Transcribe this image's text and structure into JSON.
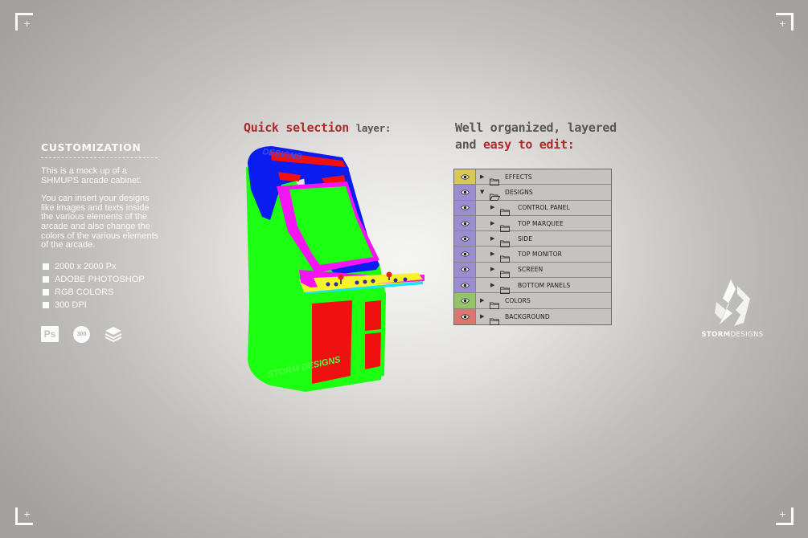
{
  "left": {
    "heading": "CUSTOMIZATION",
    "paragraph1": "This is a mock up of a SHMUPS arcade cabinet.",
    "paragraph2": "You can insert your designs like images and texts inside the various elements of the arcade and also change the colors of the various elements of the arcade.",
    "specs": [
      "2000 x 2000 Px",
      "ADOBE PHOTOSHOP",
      "RGB COLORS",
      "300 DPI"
    ],
    "icons": [
      "photoshop-icon",
      "dpi-300-icon",
      "layers-icon"
    ],
    "ps_label": "Ps",
    "dpi_label": "300"
  },
  "headings": {
    "quick_accent": "Quick selection",
    "quick_rest": "layer:",
    "well_line1": "Well organized, layered",
    "well_line2_a": "and",
    "well_line2_accent": "easy to edit:"
  },
  "arcade": {
    "watermark_top": "DESIGNS",
    "watermark_bottom": "STORM DESIGNS",
    "colors": {
      "blue": "#0a1cf0",
      "red": "#f01010",
      "green": "#1cfe12",
      "magenta": "#f614f4",
      "yellow": "#f6f32a",
      "cyan": "#18e6f8"
    }
  },
  "layers": [
    {
      "name": "EFFECTS",
      "color": "#d9c954",
      "expanded": false,
      "sub": false
    },
    {
      "name": "DESIGNS",
      "color": "#9a8ed0",
      "expanded": true,
      "sub": false
    },
    {
      "name": "CONTROL PANEL",
      "color": "#9a8ed0",
      "expanded": false,
      "sub": true
    },
    {
      "name": "TOP MARQUEE",
      "color": "#9a8ed0",
      "expanded": false,
      "sub": true
    },
    {
      "name": "SIDE",
      "color": "#9a8ed0",
      "expanded": false,
      "sub": true
    },
    {
      "name": "TOP MONITOR",
      "color": "#9a8ed0",
      "expanded": false,
      "sub": true
    },
    {
      "name": "SCREEN",
      "color": "#9a8ed0",
      "expanded": false,
      "sub": true
    },
    {
      "name": "BOTTOM PANELS",
      "color": "#9a8ed0",
      "expanded": false,
      "sub": true
    },
    {
      "name": "COLORS",
      "color": "#93c469",
      "expanded": false,
      "sub": false
    },
    {
      "name": "BACKGROUND",
      "color": "#de7670",
      "expanded": false,
      "sub": false
    }
  ],
  "logo": {
    "brand_bold": "STORM",
    "brand_light": "DESIGNS"
  }
}
